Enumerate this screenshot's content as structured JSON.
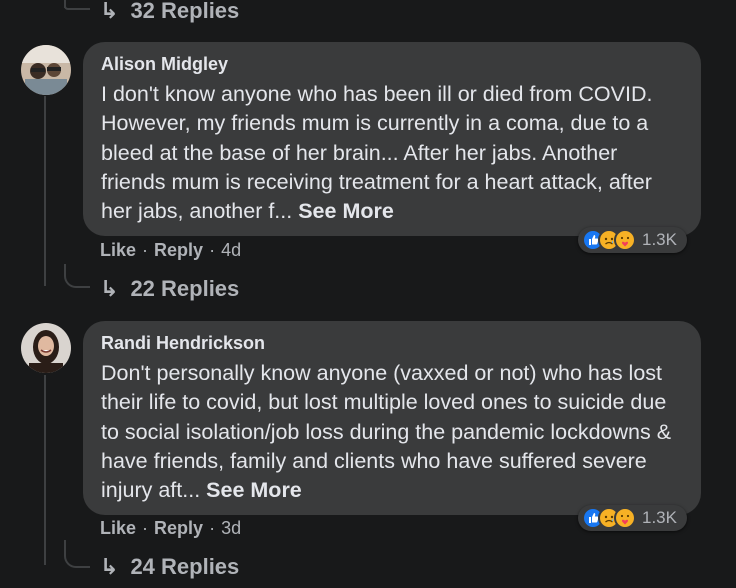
{
  "top_replies": {
    "label": "32 Replies"
  },
  "comments": [
    {
      "author": "Alison Midgley",
      "text": "I don't know anyone who has been ill or died from COVID. However, my friends mum is currently in a coma, due to a bleed at the base of her brain... After her jabs. Another friends mum is receiving treatment for a heart attack, after her jabs, another f...",
      "see_more": "See More",
      "like": "Like",
      "reply": "Reply",
      "time": "4d",
      "reaction_count": "1.3K",
      "replies": "22 Replies"
    },
    {
      "author": "Randi Hendrickson",
      "text": "Don't personally know anyone (vaxxed or not) who has lost their life to covid, but lost multiple loved ones to suicide due to social isolation/job loss during the pandemic lockdowns & have friends, family and clients who have suffered severe injury aft...",
      "see_more": "See More",
      "like": "Like",
      "reply": "Reply",
      "time": "3d",
      "reaction_count": "1.3K",
      "replies": "24 Replies"
    }
  ],
  "separator": "·",
  "colors": {
    "background": "#18191a",
    "bubble": "#3a3b3c",
    "text": "#e4e6eb",
    "muted": "#b0b3b8",
    "like_blue": "#1877f2",
    "reaction_yellow": "#f7b125"
  },
  "icons": {
    "reply_arrow": "reply-arrow-icon",
    "reactions": [
      "like-reaction-icon",
      "sad-reaction-icon",
      "care-reaction-icon"
    ]
  }
}
